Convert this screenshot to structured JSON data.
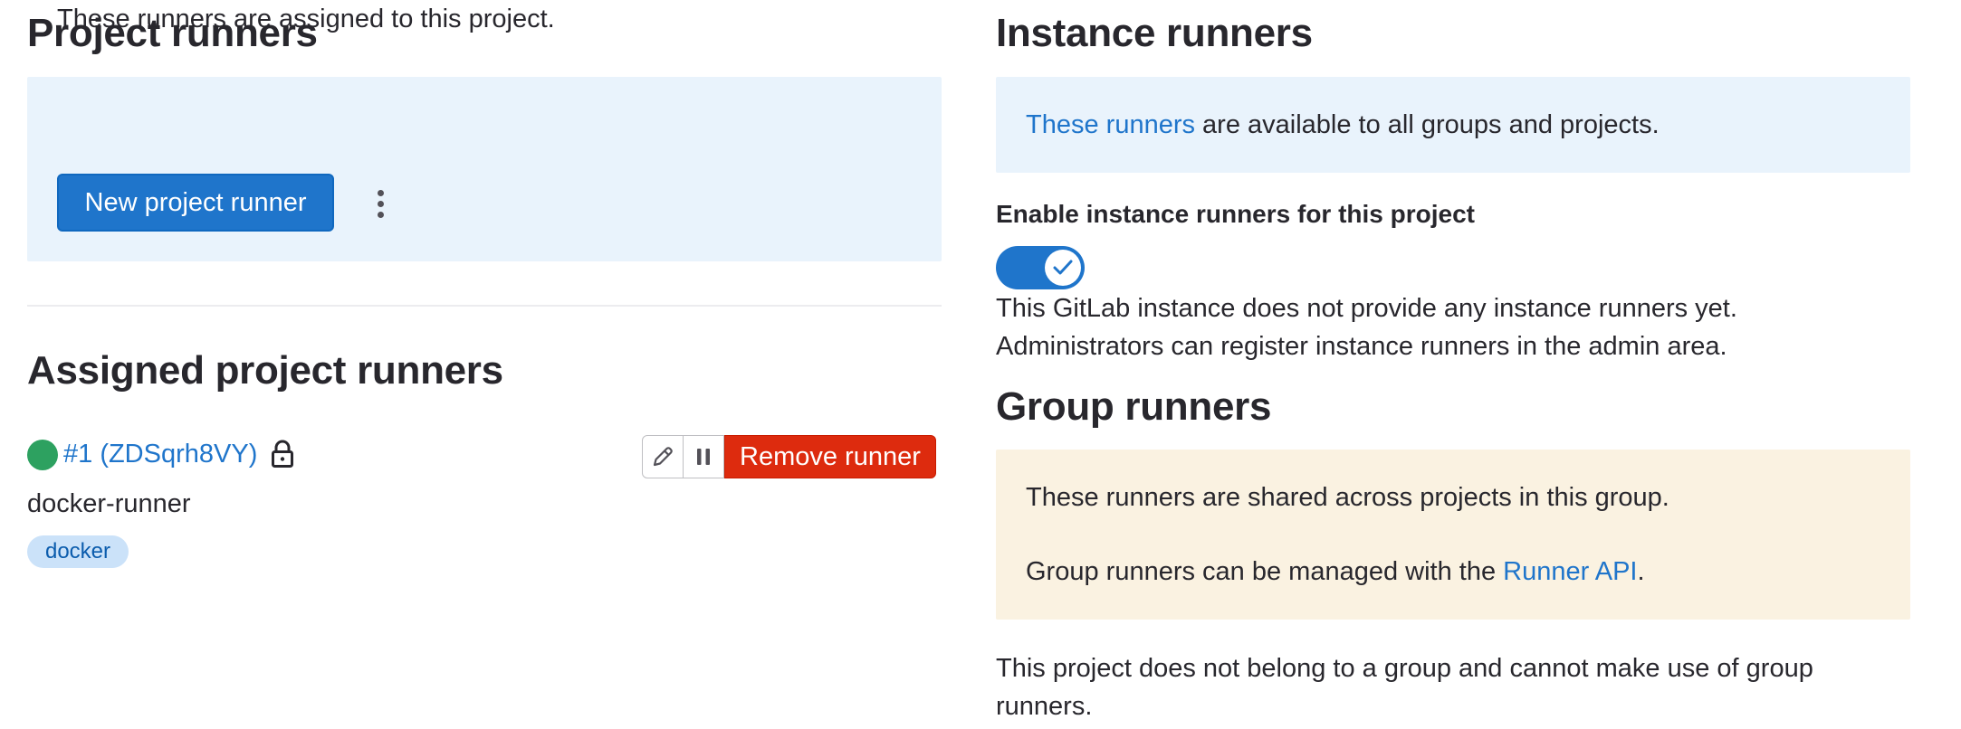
{
  "project_runners": {
    "title": "Project runners",
    "description": "These runners are assigned to this project.",
    "new_button_label": "New project runner"
  },
  "assigned": {
    "title": "Assigned project runners",
    "runner": {
      "id_label": "#1 (ZDSqrh8VY)",
      "name": "docker-runner",
      "tag": "docker",
      "status_color": "#2da160",
      "remove_label": "Remove runner"
    }
  },
  "instance_runners": {
    "title": "Instance runners",
    "link_text": "These runners",
    "description_rest": " are available to all groups and projects.",
    "toggle_label": "Enable instance runners for this project",
    "toggle_on": true,
    "info_line1": "This GitLab instance does not provide any instance runners yet.",
    "info_line2": "Administrators can register instance runners in the admin area."
  },
  "group_runners": {
    "title": "Group runners",
    "line1": "These runners are shared across projects in this group.",
    "line2_prefix": "Group runners can be managed with the ",
    "line2_link": "Runner API",
    "line2_suffix": ".",
    "footer_note": "This project does not belong to a group and cannot make use of group runners."
  },
  "colors": {
    "primary": "#1f75cb",
    "danger": "#dd2b0e",
    "info_bg": "#e9f3fc",
    "warning_bg": "#faf2e1"
  }
}
